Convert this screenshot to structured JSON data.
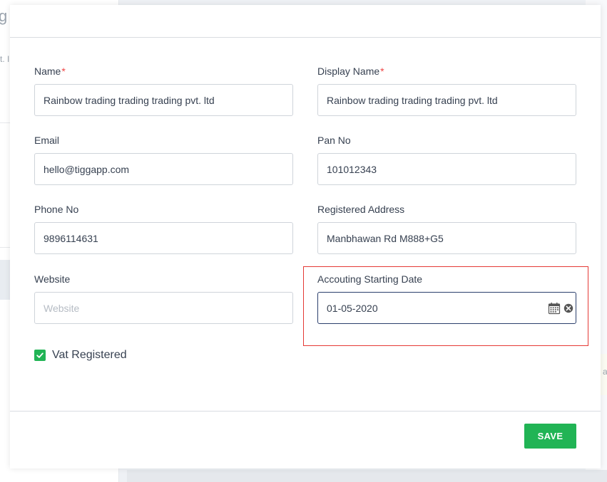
{
  "background": {
    "title_fragment": "g",
    "text_fragment": "t. I",
    "right_fragment": "a"
  },
  "form": {
    "name": {
      "label": "Name",
      "required_mark": "*",
      "value": "Rainbow trading trading trading pvt. ltd"
    },
    "display_name": {
      "label": "Display Name",
      "required_mark": "*",
      "value": "Rainbow trading trading trading pvt. ltd"
    },
    "email": {
      "label": "Email",
      "value": "hello@tiggapp.com"
    },
    "pan_no": {
      "label": "Pan No",
      "value": "101012343"
    },
    "phone_no": {
      "label": "Phone No",
      "value": "9896114631"
    },
    "registered_address": {
      "label": "Registered Address",
      "value": "Manbhawan Rd M888+G5"
    },
    "website": {
      "label": "Website",
      "value": "",
      "placeholder": "Website"
    },
    "accounting_starting_date": {
      "label": "Accouting Starting Date",
      "value": "01-05-2020",
      "icons": [
        "calendar-icon",
        "clear-icon"
      ]
    },
    "vat_registered": {
      "label": "Vat Registered",
      "checked": true
    }
  },
  "footer": {
    "save_label": "SAVE"
  },
  "colors": {
    "accent_green": "#21b455",
    "required_red": "#ef4444",
    "highlight_red": "#e53935",
    "active_border": "#2b3f6c"
  }
}
